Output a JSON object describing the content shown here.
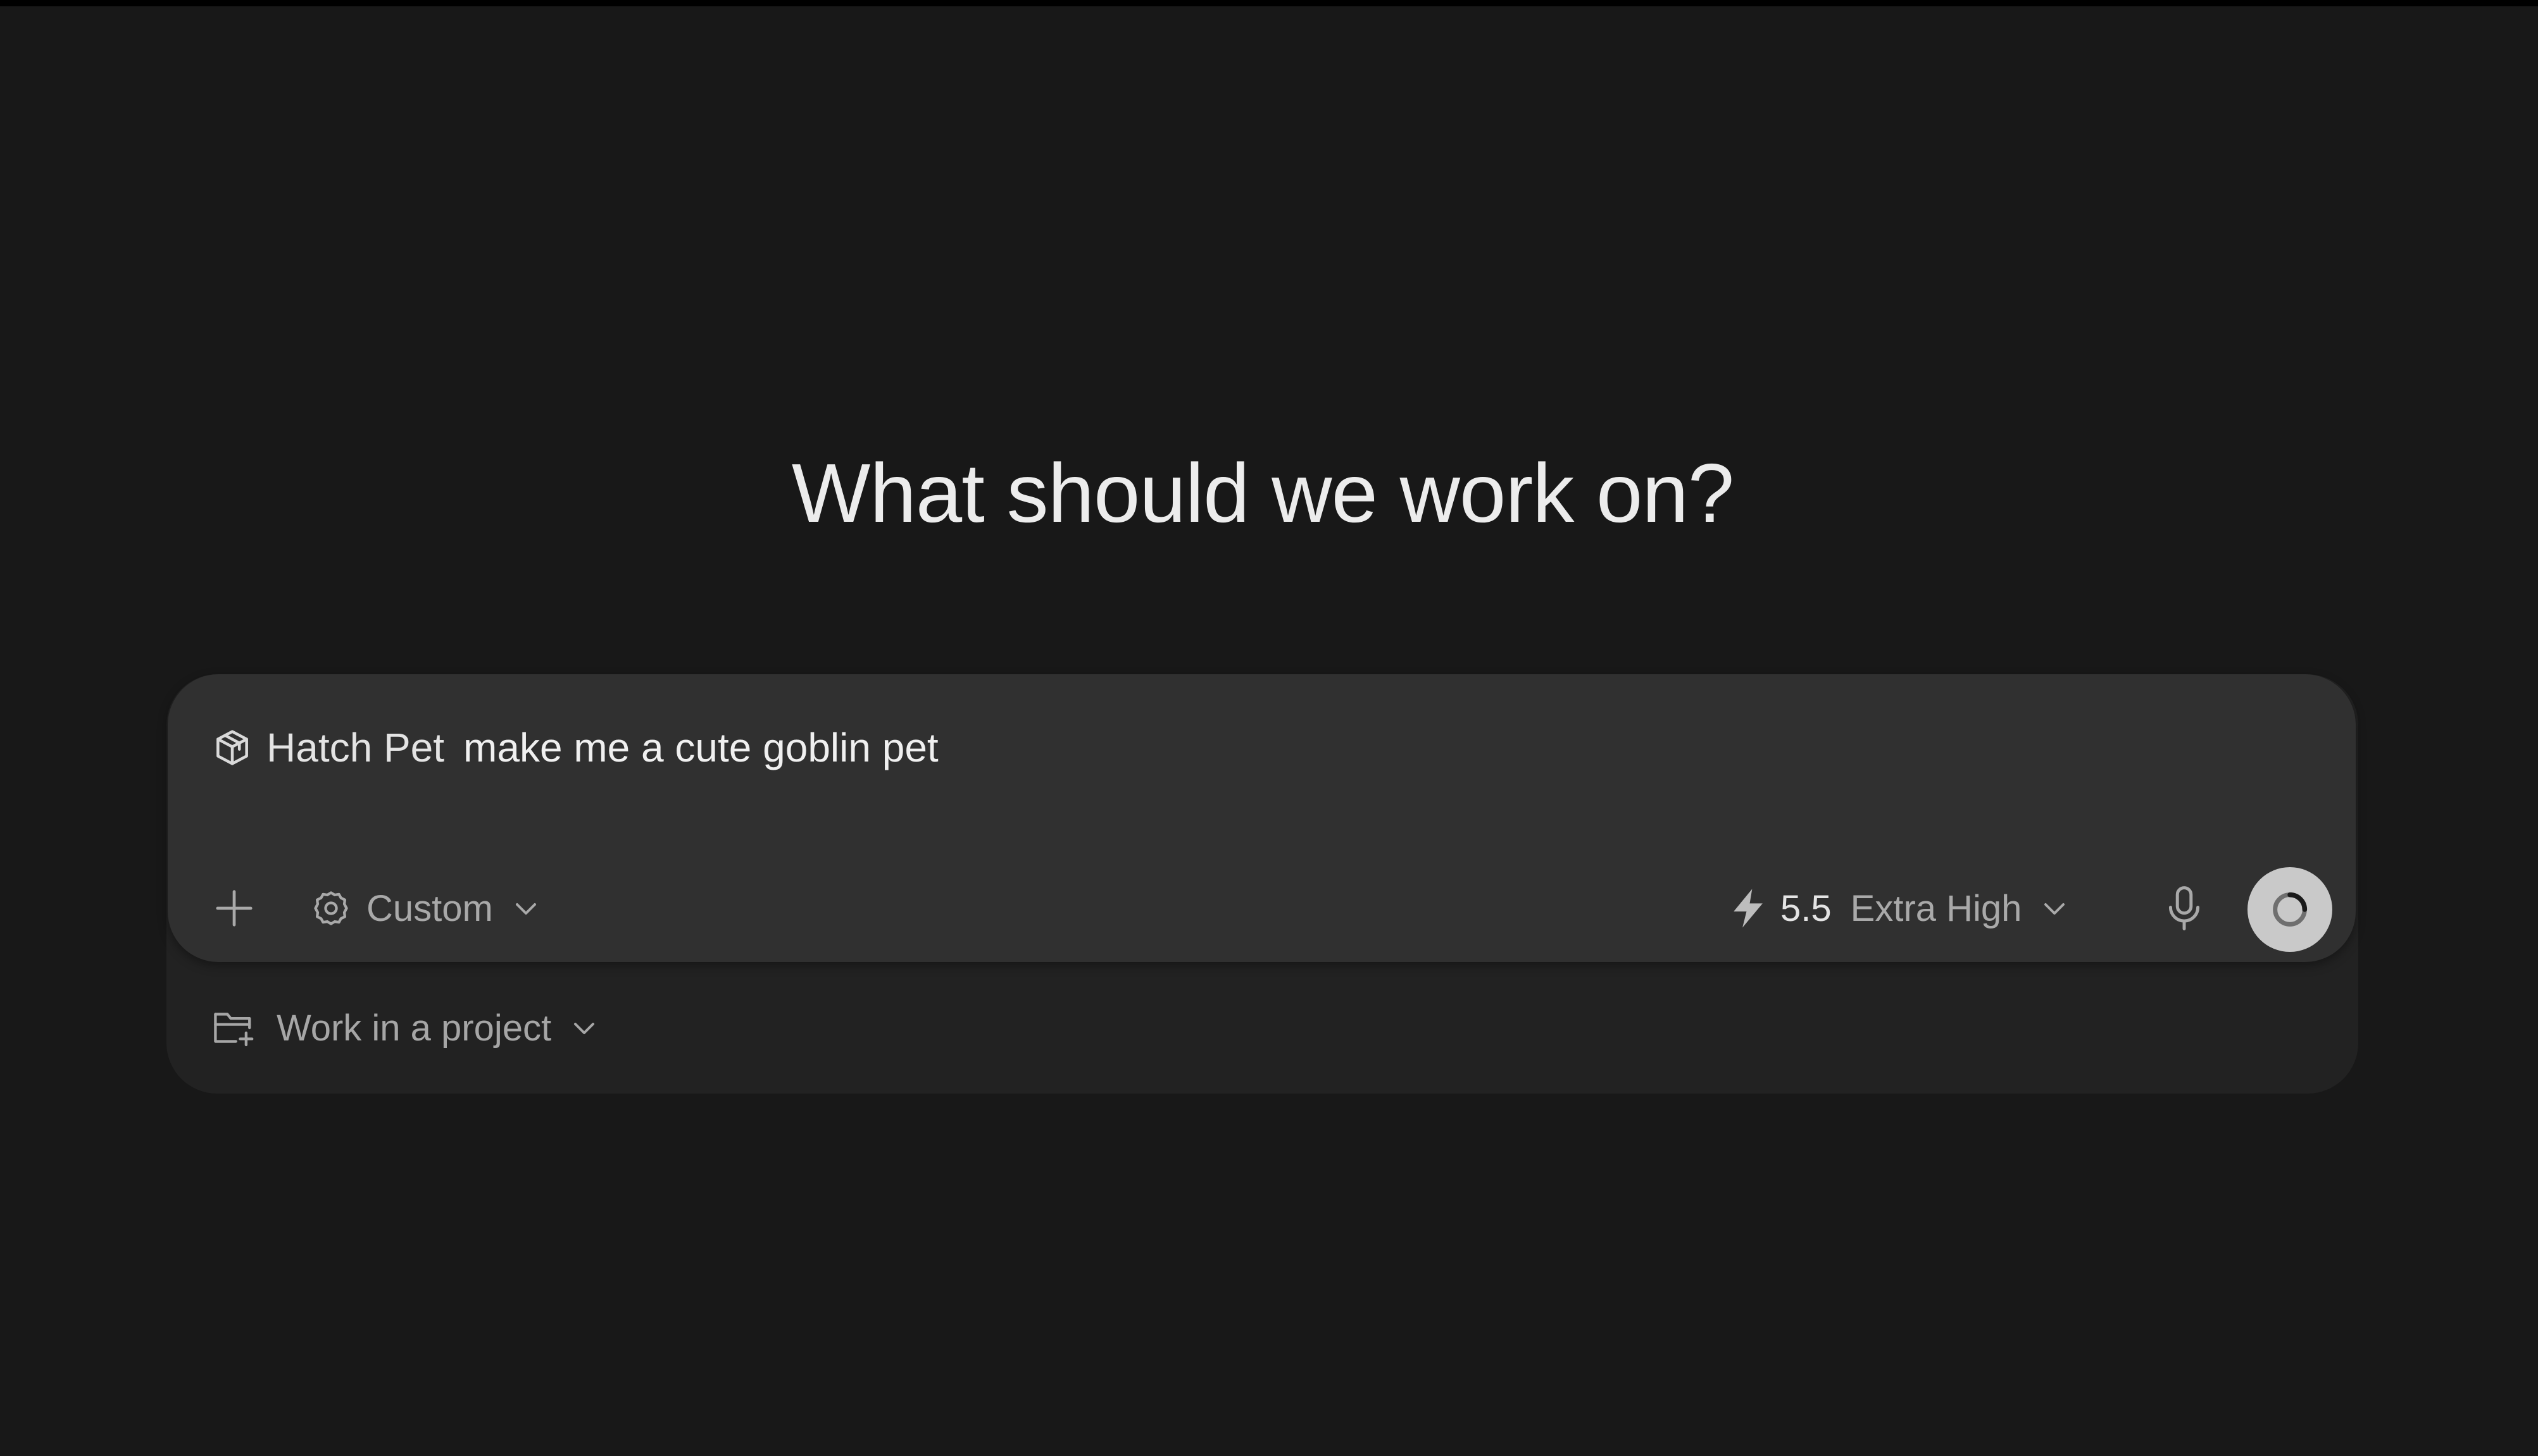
{
  "main": {
    "headline": "What should we work on?"
  },
  "composer": {
    "skill_chip": "Hatch Pet",
    "prompt_text": "make me a cute goblin pet",
    "mode_label": "Custom",
    "model_version": "5.5",
    "model_effort": "Extra High"
  },
  "project": {
    "label": "Work in a project"
  },
  "colors": {
    "background": "#181818",
    "composer": "#303030",
    "outer_card": "#222222",
    "send_button": "#c9c9c9"
  },
  "icons": {
    "skill": "package-cube-icon",
    "add": "plus-icon",
    "mode": "gear-icon",
    "model": "lightning-bolt-icon",
    "voice": "microphone-icon",
    "send": "loading-spinner-icon",
    "project": "folder-plus-icon",
    "dropdown": "chevron-down-icon"
  }
}
